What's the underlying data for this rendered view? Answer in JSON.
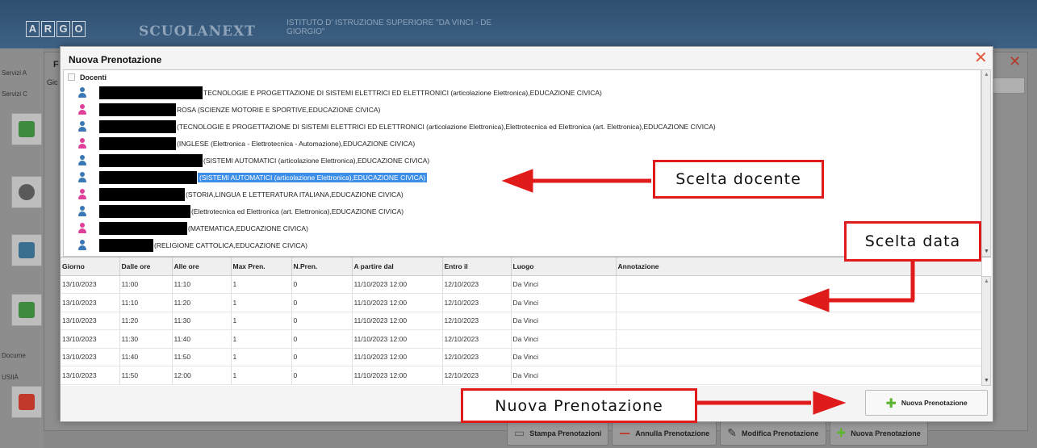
{
  "app": {
    "logo_letters": [
      "A",
      "R",
      "G",
      "O"
    ],
    "name": "SCUOLANEXT",
    "school": "ISTITUTO D' ISTRUZIONE SUPERIORE \"DA VINCI - DE GIORGIO\""
  },
  "background": {
    "window_letter": "F",
    "left_label": "Gic",
    "sidebar_labels": [
      "Servizi A",
      "Servizi C",
      "Docume",
      "USIIÀ"
    ],
    "close_symbol": "✕"
  },
  "modal": {
    "title": "Nuova Prenotazione",
    "close_symbol": "✕",
    "tree_root": "Docenti",
    "teachers": [
      {
        "gender": "m",
        "subjects": "TECNOLOGIE E PROGETTAZIONE DI SISTEMI ELETTRICI ED ELETTRONICI (articolazione Elettronica),EDUCAZIONE CIVICA)",
        "selected": false
      },
      {
        "gender": "f",
        "subjects": "ROSA (SCIENZE MOTORIE E SPORTIVE,EDUCAZIONE CIVICA)",
        "selected": false
      },
      {
        "gender": "m",
        "subjects": "(TECNOLOGIE E PROGETTAZIONE DI SISTEMI ELETTRICI ED ELETTRONICI (articolazione Elettronica),Elettrotecnica ed Elettronica (art. Elettronica),EDUCAZIONE CIVICA)",
        "selected": false
      },
      {
        "gender": "f",
        "subjects": "(INGLESE (Elettronica - Elettrotecnica - Automazione),EDUCAZIONE CIVICA)",
        "selected": false
      },
      {
        "gender": "m",
        "subjects": "(SISTEMI AUTOMATICI (articolazione Elettronica),EDUCAZIONE CIVICA)",
        "selected": false
      },
      {
        "gender": "m",
        "subjects": "(SISTEMI AUTOMATICI (articolazione Elettronica),EDUCAZIONE CIVICA)",
        "selected": true
      },
      {
        "gender": "f",
        "subjects": "(STORIA,LINGUA E LETTERATURA ITALIANA,EDUCAZIONE CIVICA)",
        "selected": false
      },
      {
        "gender": "m",
        "subjects": "(Elettrotecnica ed Elettronica (art. Elettronica),EDUCAZIONE CIVICA)",
        "selected": false
      },
      {
        "gender": "f",
        "subjects": "(MATEMATICA,EDUCAZIONE CIVICA)",
        "selected": false
      },
      {
        "gender": "m",
        "subjects": "(RELIGIONE CATTOLICA,EDUCAZIONE CIVICA)",
        "selected": false
      }
    ],
    "table": {
      "columns": [
        "Giorno",
        "Dalle ore",
        "Alle ore",
        "Max Pren.",
        "N.Pren.",
        "A partire dal",
        "Entro il",
        "Luogo",
        "Annotazione"
      ],
      "rows": [
        [
          "13/10/2023",
          "11:00",
          "11:10",
          "1",
          "0",
          "11/10/2023 12:00",
          "12/10/2023",
          "Da Vinci",
          ""
        ],
        [
          "13/10/2023",
          "11:10",
          "11:20",
          "1",
          "0",
          "11/10/2023 12:00",
          "12/10/2023",
          "Da Vinci",
          ""
        ],
        [
          "13/10/2023",
          "11:20",
          "11:30",
          "1",
          "0",
          "11/10/2023 12:00",
          "12/10/2023",
          "Da Vinci",
          ""
        ],
        [
          "13/10/2023",
          "11:30",
          "11:40",
          "1",
          "0",
          "11/10/2023 12:00",
          "12/10/2023",
          "Da Vinci",
          ""
        ],
        [
          "13/10/2023",
          "11:40",
          "11:50",
          "1",
          "0",
          "11/10/2023 12:00",
          "12/10/2023",
          "Da Vinci",
          ""
        ],
        [
          "13/10/2023",
          "11:50",
          "12:00",
          "1",
          "0",
          "11/10/2023 12:00",
          "12/10/2023",
          "Da Vinci",
          ""
        ]
      ]
    },
    "new_booking_label": "Nuova Prenotazione"
  },
  "bottom_toolbar": [
    {
      "label": "Stampa Prenotazioni",
      "icon": "print-icon",
      "color": "#555555"
    },
    {
      "label": "Annulla Prenotazione",
      "icon": "minus-icon",
      "color": "#c0392b"
    },
    {
      "label": "Modifica Prenotazione",
      "icon": "pencil-icon",
      "color": "#333333"
    },
    {
      "label": "Nuova Prenotazione",
      "icon": "plus-icon",
      "color": "#5cb431"
    }
  ],
  "annotations": {
    "teacher_choice": "Scelta docente",
    "date_choice": "Scelta data",
    "new_booking": "Nuova Prenotazione"
  },
  "colors": {
    "male_icon": "#3a78b5",
    "female_icon": "#e0409a",
    "selection": "#3d8ee6",
    "annotation_red": "#e01b1b",
    "plus_green": "#5cb431"
  }
}
